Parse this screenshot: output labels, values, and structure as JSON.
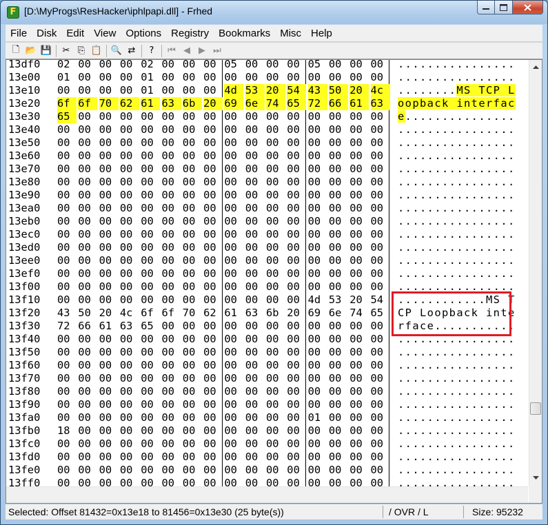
{
  "window": {
    "title": "[D:\\MyProgs\\ResHacker\\iphlpapi.dll] - Frhed",
    "app_icon_letter": "F"
  },
  "menu": [
    "File",
    "Disk",
    "Edit",
    "View",
    "Options",
    "Registry",
    "Bookmarks",
    "Misc",
    "Help"
  ],
  "toolbar": [
    {
      "icon": "new-file-icon",
      "glyph": "🗋"
    },
    {
      "icon": "open-folder-icon",
      "glyph": "📂"
    },
    {
      "icon": "save-icon",
      "glyph": "💾"
    },
    {
      "icon": "cut-icon",
      "glyph": "✂"
    },
    {
      "icon": "copy-icon",
      "glyph": "⎘"
    },
    {
      "icon": "paste-icon",
      "glyph": "📋"
    },
    {
      "icon": "find-icon",
      "glyph": "🔍"
    },
    {
      "icon": "replace-icon",
      "glyph": "⇄"
    },
    {
      "icon": "help-icon",
      "glyph": "?"
    },
    {
      "icon": "first-bookmark-icon",
      "glyph": "⏮"
    },
    {
      "icon": "prev-bookmark-icon",
      "glyph": "◀"
    },
    {
      "icon": "next-bookmark-icon",
      "glyph": "▶"
    },
    {
      "icon": "last-bookmark-icon",
      "glyph": "⏭"
    }
  ],
  "hex_rows": [
    {
      "offset": "13df0",
      "bytes": [
        "02",
        "00",
        "00",
        "00",
        "02",
        "00",
        "00",
        "00",
        "05",
        "00",
        "00",
        "00",
        "05",
        "00",
        "00",
        "00"
      ],
      "chars": "................"
    },
    {
      "offset": "13e00",
      "bytes": [
        "01",
        "00",
        "00",
        "00",
        "01",
        "00",
        "00",
        "00",
        "00",
        "00",
        "00",
        "00",
        "00",
        "00",
        "00",
        "00"
      ],
      "chars": "................"
    },
    {
      "offset": "13e10",
      "bytes": [
        "00",
        "00",
        "00",
        "00",
        "01",
        "00",
        "00",
        "00",
        "4d",
        "53",
        "20",
        "54",
        "43",
        "50",
        "20",
        "4c"
      ],
      "chars": "........MS TCP L"
    },
    {
      "offset": "13e20",
      "bytes": [
        "6f",
        "6f",
        "70",
        "62",
        "61",
        "63",
        "6b",
        "20",
        "69",
        "6e",
        "74",
        "65",
        "72",
        "66",
        "61",
        "63"
      ],
      "chars": "oopback interfac"
    },
    {
      "offset": "13e30",
      "bytes": [
        "65",
        "00",
        "00",
        "00",
        "00",
        "00",
        "00",
        "00",
        "00",
        "00",
        "00",
        "00",
        "00",
        "00",
        "00",
        "00"
      ],
      "chars": "e..............."
    },
    {
      "offset": "13e40",
      "bytes": [
        "00",
        "00",
        "00",
        "00",
        "00",
        "00",
        "00",
        "00",
        "00",
        "00",
        "00",
        "00",
        "00",
        "00",
        "00",
        "00"
      ],
      "chars": "................"
    },
    {
      "offset": "13e50",
      "bytes": [
        "00",
        "00",
        "00",
        "00",
        "00",
        "00",
        "00",
        "00",
        "00",
        "00",
        "00",
        "00",
        "00",
        "00",
        "00",
        "00"
      ],
      "chars": "................"
    },
    {
      "offset": "13e60",
      "bytes": [
        "00",
        "00",
        "00",
        "00",
        "00",
        "00",
        "00",
        "00",
        "00",
        "00",
        "00",
        "00",
        "00",
        "00",
        "00",
        "00"
      ],
      "chars": "................"
    },
    {
      "offset": "13e70",
      "bytes": [
        "00",
        "00",
        "00",
        "00",
        "00",
        "00",
        "00",
        "00",
        "00",
        "00",
        "00",
        "00",
        "00",
        "00",
        "00",
        "00"
      ],
      "chars": "................"
    },
    {
      "offset": "13e80",
      "bytes": [
        "00",
        "00",
        "00",
        "00",
        "00",
        "00",
        "00",
        "00",
        "00",
        "00",
        "00",
        "00",
        "00",
        "00",
        "00",
        "00"
      ],
      "chars": "................"
    },
    {
      "offset": "13e90",
      "bytes": [
        "00",
        "00",
        "00",
        "00",
        "00",
        "00",
        "00",
        "00",
        "00",
        "00",
        "00",
        "00",
        "00",
        "00",
        "00",
        "00"
      ],
      "chars": "................"
    },
    {
      "offset": "13ea0",
      "bytes": [
        "00",
        "00",
        "00",
        "00",
        "00",
        "00",
        "00",
        "00",
        "00",
        "00",
        "00",
        "00",
        "00",
        "00",
        "00",
        "00"
      ],
      "chars": "................"
    },
    {
      "offset": "13eb0",
      "bytes": [
        "00",
        "00",
        "00",
        "00",
        "00",
        "00",
        "00",
        "00",
        "00",
        "00",
        "00",
        "00",
        "00",
        "00",
        "00",
        "00"
      ],
      "chars": "................"
    },
    {
      "offset": "13ec0",
      "bytes": [
        "00",
        "00",
        "00",
        "00",
        "00",
        "00",
        "00",
        "00",
        "00",
        "00",
        "00",
        "00",
        "00",
        "00",
        "00",
        "00"
      ],
      "chars": "................"
    },
    {
      "offset": "13ed0",
      "bytes": [
        "00",
        "00",
        "00",
        "00",
        "00",
        "00",
        "00",
        "00",
        "00",
        "00",
        "00",
        "00",
        "00",
        "00",
        "00",
        "00"
      ],
      "chars": "................"
    },
    {
      "offset": "13ee0",
      "bytes": [
        "00",
        "00",
        "00",
        "00",
        "00",
        "00",
        "00",
        "00",
        "00",
        "00",
        "00",
        "00",
        "00",
        "00",
        "00",
        "00"
      ],
      "chars": "................"
    },
    {
      "offset": "13ef0",
      "bytes": [
        "00",
        "00",
        "00",
        "00",
        "00",
        "00",
        "00",
        "00",
        "00",
        "00",
        "00",
        "00",
        "00",
        "00",
        "00",
        "00"
      ],
      "chars": "................"
    },
    {
      "offset": "13f00",
      "bytes": [
        "00",
        "00",
        "00",
        "00",
        "00",
        "00",
        "00",
        "00",
        "00",
        "00",
        "00",
        "00",
        "00",
        "00",
        "00",
        "00"
      ],
      "chars": "................"
    },
    {
      "offset": "13f10",
      "bytes": [
        "00",
        "00",
        "00",
        "00",
        "00",
        "00",
        "00",
        "00",
        "00",
        "00",
        "00",
        "00",
        "4d",
        "53",
        "20",
        "54"
      ],
      "chars": "............MS T"
    },
    {
      "offset": "13f20",
      "bytes": [
        "43",
        "50",
        "20",
        "4c",
        "6f",
        "6f",
        "70",
        "62",
        "61",
        "63",
        "6b",
        "20",
        "69",
        "6e",
        "74",
        "65"
      ],
      "chars": "CP Loopback inte"
    },
    {
      "offset": "13f30",
      "bytes": [
        "72",
        "66",
        "61",
        "63",
        "65",
        "00",
        "00",
        "00",
        "00",
        "00",
        "00",
        "00",
        "00",
        "00",
        "00",
        "00"
      ],
      "chars": "rface..........."
    },
    {
      "offset": "13f40",
      "bytes": [
        "00",
        "00",
        "00",
        "00",
        "00",
        "00",
        "00",
        "00",
        "00",
        "00",
        "00",
        "00",
        "00",
        "00",
        "00",
        "00"
      ],
      "chars": "................"
    },
    {
      "offset": "13f50",
      "bytes": [
        "00",
        "00",
        "00",
        "00",
        "00",
        "00",
        "00",
        "00",
        "00",
        "00",
        "00",
        "00",
        "00",
        "00",
        "00",
        "00"
      ],
      "chars": "................"
    },
    {
      "offset": "13f60",
      "bytes": [
        "00",
        "00",
        "00",
        "00",
        "00",
        "00",
        "00",
        "00",
        "00",
        "00",
        "00",
        "00",
        "00",
        "00",
        "00",
        "00"
      ],
      "chars": "................"
    },
    {
      "offset": "13f70",
      "bytes": [
        "00",
        "00",
        "00",
        "00",
        "00",
        "00",
        "00",
        "00",
        "00",
        "00",
        "00",
        "00",
        "00",
        "00",
        "00",
        "00"
      ],
      "chars": "................"
    },
    {
      "offset": "13f80",
      "bytes": [
        "00",
        "00",
        "00",
        "00",
        "00",
        "00",
        "00",
        "00",
        "00",
        "00",
        "00",
        "00",
        "00",
        "00",
        "00",
        "00"
      ],
      "chars": "................"
    },
    {
      "offset": "13f90",
      "bytes": [
        "00",
        "00",
        "00",
        "00",
        "00",
        "00",
        "00",
        "00",
        "00",
        "00",
        "00",
        "00",
        "00",
        "00",
        "00",
        "00"
      ],
      "chars": "................"
    },
    {
      "offset": "13fa0",
      "bytes": [
        "00",
        "00",
        "00",
        "00",
        "00",
        "00",
        "00",
        "00",
        "00",
        "00",
        "00",
        "00",
        "01",
        "00",
        "00",
        "00"
      ],
      "chars": "................"
    },
    {
      "offset": "13fb0",
      "bytes": [
        "18",
        "00",
        "00",
        "00",
        "00",
        "00",
        "00",
        "00",
        "00",
        "00",
        "00",
        "00",
        "00",
        "00",
        "00",
        "00"
      ],
      "chars": "................"
    },
    {
      "offset": "13fc0",
      "bytes": [
        "00",
        "00",
        "00",
        "00",
        "00",
        "00",
        "00",
        "00",
        "00",
        "00",
        "00",
        "00",
        "00",
        "00",
        "00",
        "00"
      ],
      "chars": "................"
    },
    {
      "offset": "13fd0",
      "bytes": [
        "00",
        "00",
        "00",
        "00",
        "00",
        "00",
        "00",
        "00",
        "00",
        "00",
        "00",
        "00",
        "00",
        "00",
        "00",
        "00"
      ],
      "chars": "................"
    },
    {
      "offset": "13fe0",
      "bytes": [
        "00",
        "00",
        "00",
        "00",
        "00",
        "00",
        "00",
        "00",
        "00",
        "00",
        "00",
        "00",
        "00",
        "00",
        "00",
        "00"
      ],
      "chars": "................"
    },
    {
      "offset": "13ff0",
      "bytes": [
        "00",
        "00",
        "00",
        "00",
        "00",
        "00",
        "00",
        "00",
        "00",
        "00",
        "00",
        "00",
        "00",
        "00",
        "00",
        "00"
      ],
      "chars": "................"
    }
  ],
  "selection": {
    "from_row": 2,
    "from_col": 8,
    "to_row": 4,
    "to_col": 0
  },
  "colors": {
    "selection": "#ffff20",
    "annotation_box": "#e01b24"
  },
  "status": {
    "selection_text": "Selected: Offset 81432=0x13e18 to 81456=0x13e30 (25 byte(s))",
    "mode_text": "/ OVR / L",
    "size_text": "Size: 95232"
  }
}
